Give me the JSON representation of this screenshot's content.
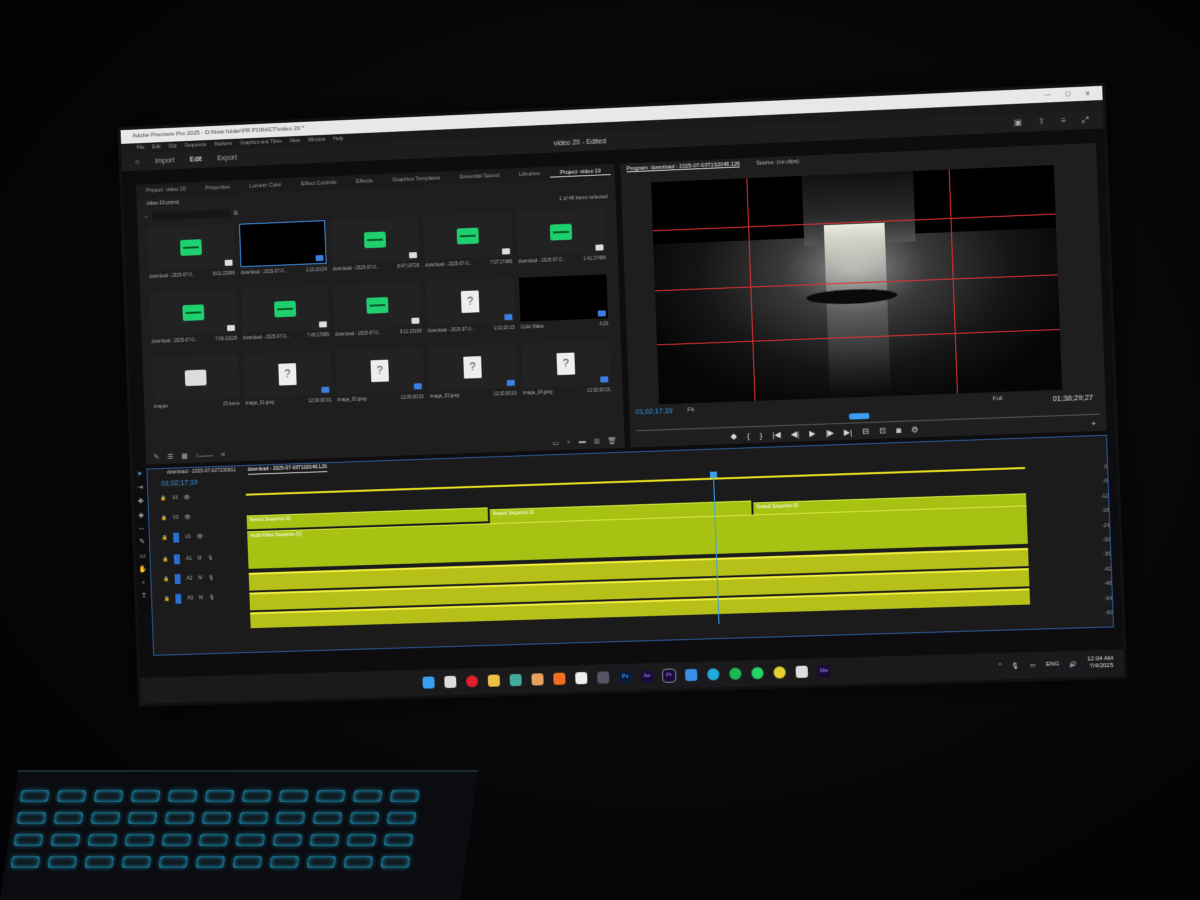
{
  "app": {
    "title_text": "Adobe Premiere Pro 2025 - D:\\New folder\\PR PORACT\\video 20 *",
    "menu": [
      "File",
      "Edit",
      "Clip",
      "Sequence",
      "Markers",
      "Graphics and Titles",
      "View",
      "Window",
      "Help"
    ],
    "workspace_tabs": [
      "Import",
      "Edit",
      "Export"
    ],
    "project_title": "video 20 - Edited"
  },
  "panel_tabs": [
    "Project: video 20",
    "Properties",
    "Lumetri Color",
    "Effect Controls",
    "Effects",
    "Graphics Templates",
    "Essential Sound",
    "Libraries",
    "Project: video 19"
  ],
  "project": {
    "bin_label": "video 19.prproj",
    "selection_text": "1 of 46 items selected",
    "items": [
      {
        "type": "audio",
        "name": "download - 2025-07-0...",
        "duration": "8:01:22966"
      },
      {
        "type": "selected",
        "name": "download - 2025-07-0...",
        "duration": "1;10;20;04"
      },
      {
        "type": "audio",
        "name": "download - 2025-07-0...",
        "duration": "8:47:19726"
      },
      {
        "type": "audio",
        "name": "download - 2025-07-0...",
        "duration": "7:07:27486"
      },
      {
        "type": "audio",
        "name": "download - 2025-07-0...",
        "duration": "1:41:27486"
      },
      {
        "type": "audio",
        "name": "download - 2025-07-0...",
        "duration": "7:00:10126"
      },
      {
        "type": "audio",
        "name": "download - 2025-07-0...",
        "duration": "7:45:17086"
      },
      {
        "type": "audio",
        "name": "download - 2025-07-0...",
        "duration": "9:11:15166"
      },
      {
        "type": "doc",
        "name": "download - 2025-07-0...",
        "duration": "1;10;20;15"
      },
      {
        "type": "matte",
        "name": "Color Matte",
        "duration": "4;29"
      },
      {
        "type": "folder",
        "name": "images",
        "duration": "25 items"
      },
      {
        "type": "doc",
        "name": "image_01.jpeg",
        "duration": "12;00;00;01"
      },
      {
        "type": "doc",
        "name": "image_02.jpeg",
        "duration": "12;00;00;01"
      },
      {
        "type": "doc",
        "name": "image_03.jpeg",
        "duration": "12;00;00;01"
      },
      {
        "type": "doc",
        "name": "image_04.jpeg",
        "duration": "12;00;00;01"
      }
    ]
  },
  "program": {
    "tab_program": "Program: download - 2025-07-03T192048.126",
    "tab_source": "Source: (no clips)",
    "timecode": "01;02;17;19",
    "fit": "Fit",
    "quality": "Full",
    "duration": "01;38;29;27"
  },
  "timeline": {
    "tabs": [
      "download - 2025-07-02T230911",
      "download - 2025-07-03T192048.126"
    ],
    "timecode": "01;02;17;19",
    "tracks": [
      "V3",
      "V2",
      "V1",
      "A1",
      "A2",
      "A3"
    ],
    "clips": [
      "Nested Sequence 01",
      "Nested Sequence 01",
      "Nested Sequence 01",
      "Audio/Video Sequence [V]"
    ],
    "meter_scale": [
      "0",
      "-6",
      "-12",
      "-18",
      "-24",
      "-30",
      "-36",
      "-42",
      "-48",
      "-54",
      "-60"
    ]
  },
  "taskbar": {
    "lang": "ENG",
    "time": "12:04 AM",
    "date": "7/4/2025",
    "app_labels": [
      "Ps",
      "Ae",
      "Pr",
      "Me"
    ]
  }
}
